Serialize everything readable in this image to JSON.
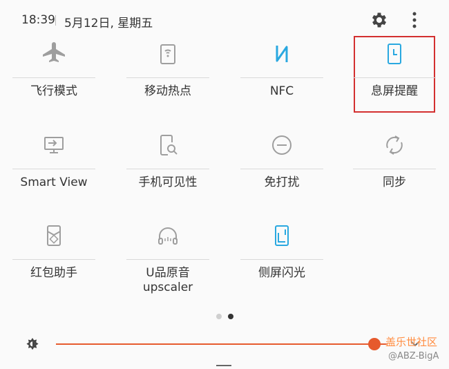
{
  "status": {
    "time": "18:39",
    "date": "5月12日, 星期五"
  },
  "tiles": [
    {
      "label": "飞行模式",
      "icon": "airplane-icon",
      "active": false
    },
    {
      "label": "移动热点",
      "icon": "hotspot-icon",
      "active": false
    },
    {
      "label": "NFC",
      "icon": "nfc-icon",
      "active": true
    },
    {
      "label": "息屏提醒",
      "icon": "always-on-display-icon",
      "active": true
    },
    {
      "label": "Smart View",
      "icon": "smart-view-icon",
      "active": false
    },
    {
      "label": "手机可见性",
      "icon": "phone-visibility-icon",
      "active": false
    },
    {
      "label": "免打扰",
      "icon": "do-not-disturb-icon",
      "active": false
    },
    {
      "label": "同步",
      "icon": "sync-icon",
      "active": false
    },
    {
      "label": "红包助手",
      "icon": "red-envelope-icon",
      "active": false
    },
    {
      "label": "U品原音\nupscaler",
      "icon": "headphones-icon",
      "active": false
    },
    {
      "label": "侧屏闪光",
      "icon": "edge-lighting-icon",
      "active": true
    }
  ],
  "pager": {
    "page": 2,
    "total": 2
  },
  "brightness": {
    "level": 0.96
  },
  "colors": {
    "active": "#29a8e0",
    "inactive": "#9e9e9e",
    "accent": "#e65a2d",
    "highlight": "#d32f2f"
  },
  "watermark": {
    "line1": "盖乐世社区",
    "line2": "@ABZ-BigA"
  }
}
